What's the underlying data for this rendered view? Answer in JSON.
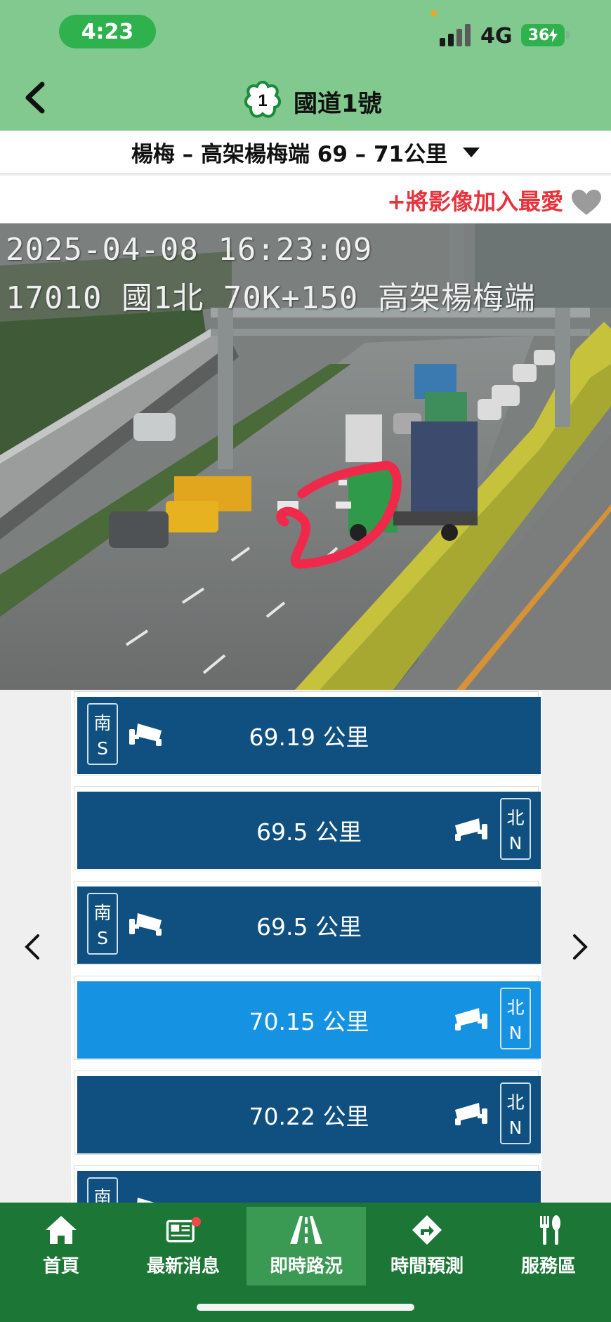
{
  "status": {
    "time": "4:23",
    "network": "4G",
    "battery": "36"
  },
  "header": {
    "badge_number": "1",
    "title": "國道1號"
  },
  "section": {
    "label": "楊梅 – 高架楊梅端 69 – 71公里"
  },
  "favorite": {
    "label": "將影像加入最愛",
    "plus": "+"
  },
  "camera_overlay": {
    "timestamp": "2025-04-08 16:23:09",
    "location": "17010 國1北 70K+150 高架楊梅端"
  },
  "camera_list": [
    {
      "km": "69.19 公里",
      "dir_cn": "南",
      "dir_en": "S",
      "side": "left",
      "active": false
    },
    {
      "km": "69.5 公里",
      "dir_cn": "北",
      "dir_en": "N",
      "side": "right",
      "active": false
    },
    {
      "km": "69.5 公里",
      "dir_cn": "南",
      "dir_en": "S",
      "side": "left",
      "active": false
    },
    {
      "km": "70.15 公里",
      "dir_cn": "北",
      "dir_en": "N",
      "side": "right",
      "active": true
    },
    {
      "km": "70.22 公里",
      "dir_cn": "北",
      "dir_en": "N",
      "side": "right",
      "active": false
    },
    {
      "km": "",
      "dir_cn": "南",
      "dir_en": "S",
      "side": "left",
      "active": false
    }
  ],
  "tabs": [
    {
      "label": "首頁",
      "icon": "home-icon",
      "active": false
    },
    {
      "label": "最新消息",
      "icon": "news-icon",
      "active": false
    },
    {
      "label": "即時路況",
      "icon": "road-icon",
      "active": true
    },
    {
      "label": "時間預測",
      "icon": "route-sign-icon",
      "active": false
    },
    {
      "label": "服務區",
      "icon": "fork-knife-icon",
      "active": false
    }
  ],
  "colors": {
    "header_green": "#81c98e",
    "tab_green": "#1c7636",
    "row_blue": "#0f5080",
    "row_active": "#1592e2",
    "favorite_red": "#e8323c",
    "annotation_red": "#f0294b"
  }
}
